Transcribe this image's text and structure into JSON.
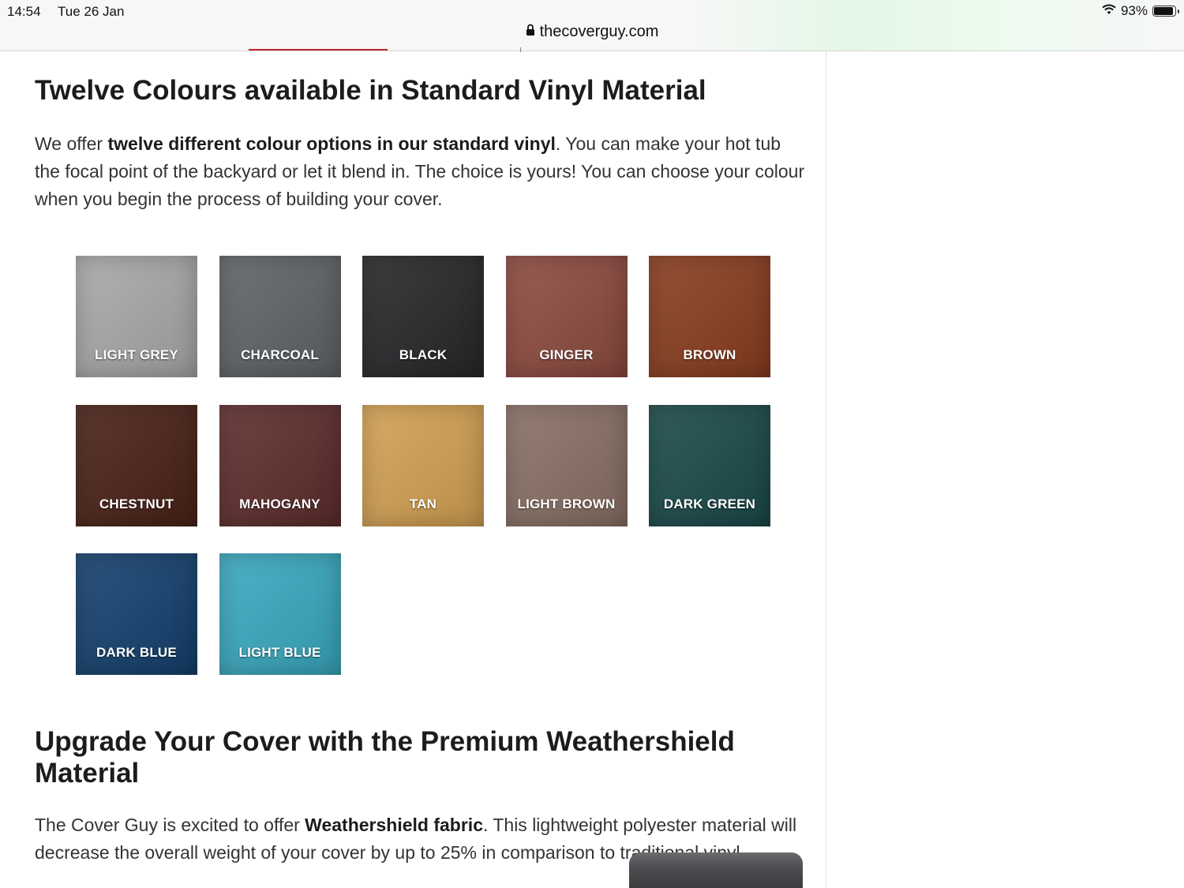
{
  "status": {
    "time": "14:54",
    "date": "Tue 26 Jan",
    "battery": "93%",
    "battery_level": 0.93
  },
  "browser": {
    "url": "thecoverguy.com"
  },
  "section1": {
    "heading": "Twelve Colours available in Standard Vinyl Material",
    "para_pre": "We offer ",
    "para_bold": "twelve different colour options in our standard vinyl",
    "para_post": ". You can make your hot tub the focal point of the backyard or let it blend in. The choice is yours! You can choose your colour when you begin the process of building your cover."
  },
  "swatches": [
    {
      "label": "LIGHT GREY",
      "color": "#a7a9aa"
    },
    {
      "label": "CHARCOAL",
      "color": "#5f6467"
    },
    {
      "label": "BLACK",
      "color": "#26282a"
    },
    {
      "label": "GINGER",
      "color": "#8d4b40"
    },
    {
      "label": "BROWN",
      "color": "#8a3e1f"
    },
    {
      "label": "CHESTNUT",
      "color": "#4a2218"
    },
    {
      "label": "MAHOGANY",
      "color": "#5e2e2d"
    },
    {
      "label": "TAN",
      "color": "#d3a253"
    },
    {
      "label": "LIGHT BROWN",
      "color": "#8a7165"
    },
    {
      "label": "DARK GREEN",
      "color": "#1c4a4b"
    },
    {
      "label": "DARK BLUE",
      "color": "#15416e"
    },
    {
      "label": "LIGHT BLUE",
      "color": "#3aa9bf"
    }
  ],
  "section2": {
    "heading": "Upgrade Your Cover with the Premium Weathershield Material",
    "para_pre": "The Cover Guy is excited to offer ",
    "para_bold": "Weathershield fabric",
    "para_post": ". This lightweight polyester material will decrease the overall weight of your cover by up to 25% in comparison to traditional vinyl."
  }
}
